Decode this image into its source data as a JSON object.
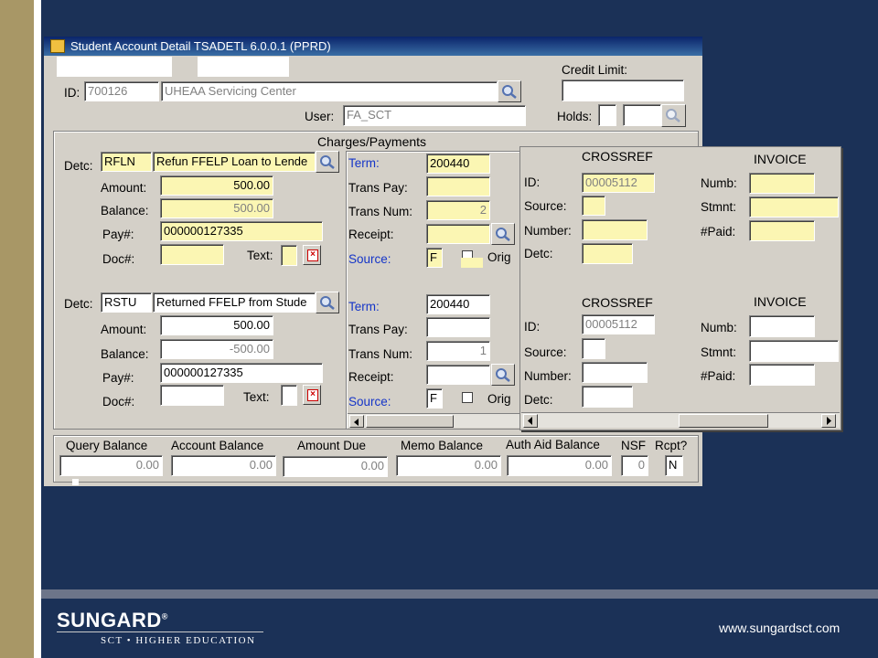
{
  "window": {
    "title": "Student Account Detail  TSADETL  6.0.0.1  (PPRD)"
  },
  "header": {
    "id_label": "ID:",
    "id_value": "700126",
    "name_value": "UHEAA Servicing Center",
    "user_label": "User:",
    "user_value": "FA_SCT",
    "credit_limit_label": "Credit Limit:",
    "holds_label": "Holds:"
  },
  "charges": {
    "section_title": "Charges/Payments",
    "labels": {
      "detc": "Detc:",
      "amount": "Amount:",
      "balance": "Balance:",
      "pay": "Pay#:",
      "doc": "Doc#:",
      "text": "Text:",
      "term": "Term:",
      "trans_pay": "Trans Pay:",
      "trans_num": "Trans Num:",
      "receipt": "Receipt:",
      "source": "Source:",
      "orig": "Orig"
    },
    "rows": [
      {
        "detc_code": "RFLN",
        "detc_desc": "Refun FFELP Loan to Lende",
        "amount": "500.00",
        "balance": "500.00",
        "pay_number": "000000127335",
        "term": "200440",
        "trans_num": "2",
        "source": "F"
      },
      {
        "detc_code": "RSTU",
        "detc_desc": "Returned FFELP from Stude",
        "amount": "500.00",
        "balance": "-500.00",
        "pay_number": "000000127335",
        "term": "200440",
        "trans_num": "1",
        "source": "F"
      }
    ]
  },
  "crossref": {
    "crossref_title": "CROSSREF",
    "invoice_title": "INVOICE",
    "labels": {
      "id": "ID:",
      "source": "Source:",
      "number": "Number:",
      "detc": "Detc:",
      "numb": "Numb:",
      "stmnt": "Stmnt:",
      "paid": "#Paid:"
    },
    "rows": [
      {
        "id": "00005112"
      },
      {
        "id": "00005112"
      }
    ]
  },
  "totals": {
    "query_balance_label": "Query Balance",
    "query_balance": "0.00",
    "account_balance_label": "Account Balance",
    "account_balance": "0.00",
    "amount_due_label": "Amount Due",
    "amount_due": "0.00",
    "memo_balance_label": "Memo Balance",
    "memo_balance": "0.00",
    "auth_aid_label": "Auth Aid Balance",
    "auth_aid": "0.00",
    "nsf_label": "NSF",
    "nsf": "0",
    "rcpt_label": "Rcpt?",
    "rcpt": "N"
  },
  "branding": {
    "logo_main": "SUNGARD",
    "logo_mark": "®",
    "logo_sub": "SCT • HIGHER EDUCATION",
    "url": "www.sungardsct.com"
  },
  "colors": {
    "background": "#1b3157",
    "accent_gold": "#a89766",
    "required_field": "#fbf6b3",
    "titlebar": "#0a246a",
    "blue_label": "#1535c8"
  }
}
